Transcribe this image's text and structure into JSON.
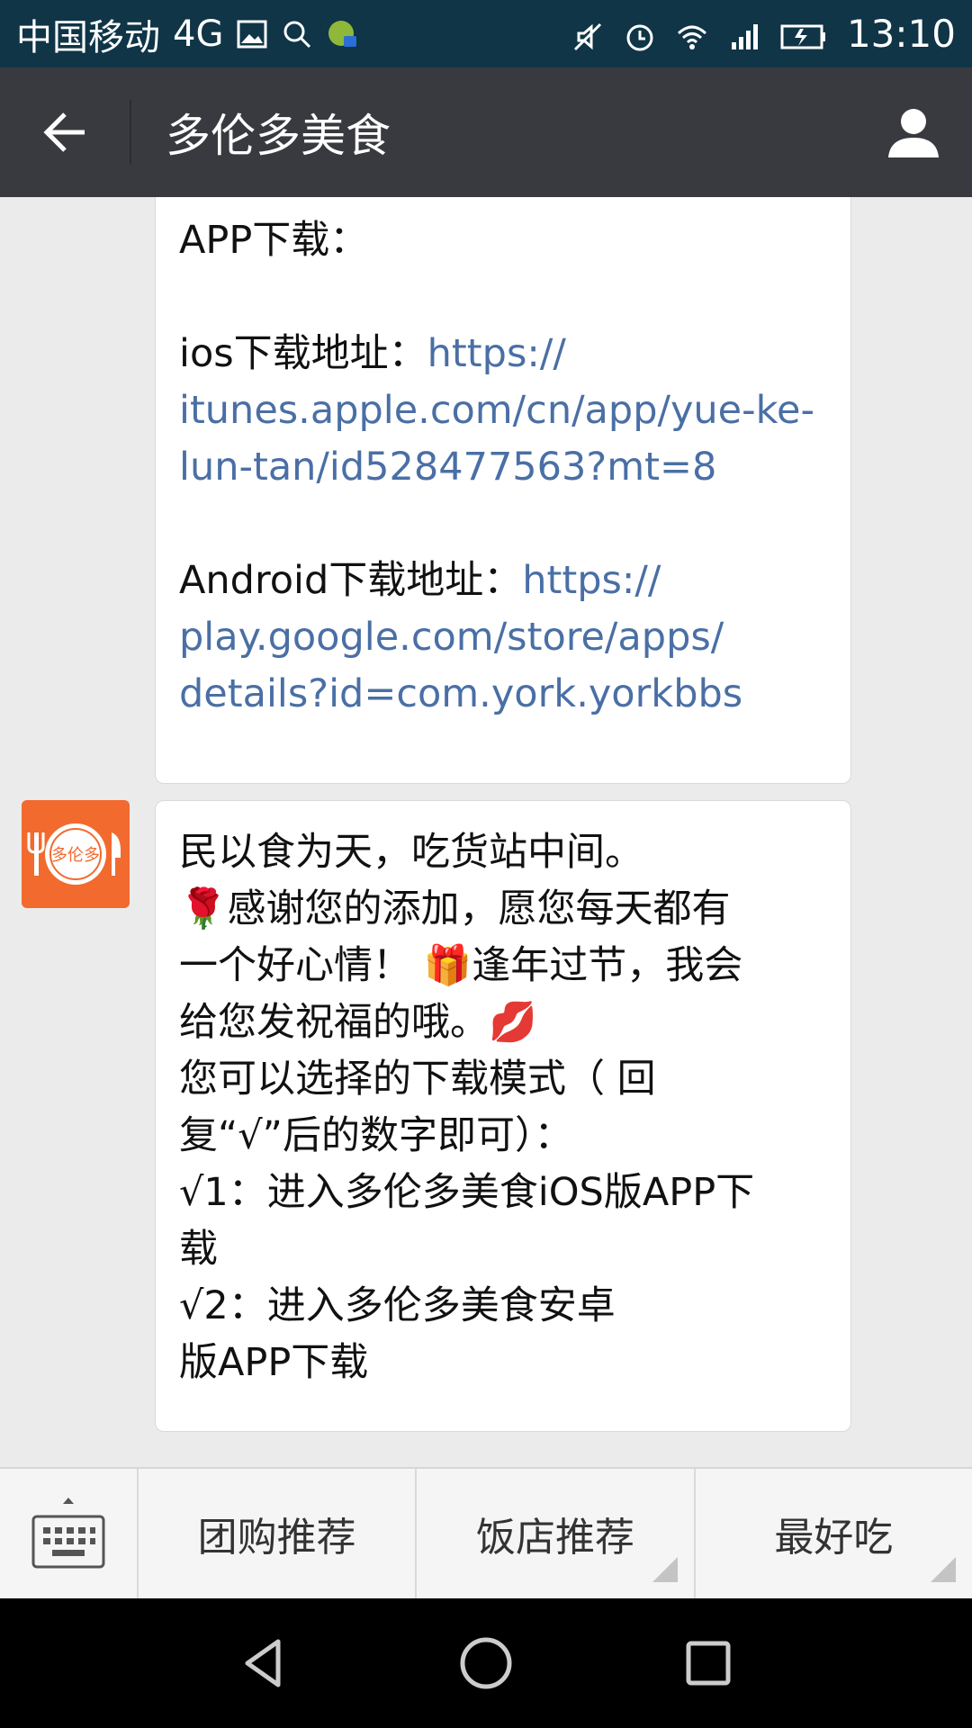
{
  "status_bar": {
    "carrier": "中国移动",
    "network": "4G",
    "time": "13:10",
    "icons": [
      "image-icon",
      "search-icon",
      "app-notification-icon",
      "mute-icon",
      "alarm-icon",
      "wifi-icon",
      "signal-icon",
      "battery-icon"
    ]
  },
  "header": {
    "title": "多伦多美食",
    "back_icon": "back-arrow-icon",
    "profile_icon": "person-icon"
  },
  "messages": [
    {
      "lines": [
        {
          "text": "APP下载：",
          "link": ""
        },
        {
          "gap": true
        },
        {
          "text": "ios下载地址：",
          "link": "https://"
        },
        {
          "text": "",
          "link": "itunes.apple.com/cn/app/yue-ke-"
        },
        {
          "text": "",
          "link": "lun-tan/id528477563?mt=8"
        },
        {
          "gap": true
        },
        {
          "text": "Android下载地址：",
          "link": "https://"
        },
        {
          "text": "",
          "link": "play.google.com/store/apps/"
        },
        {
          "text": "",
          "link": "details?id=com.york.yorkbbs"
        }
      ]
    },
    {
      "avatar_text": "多伦多",
      "lines": [
        "民以食为天，吃货站中间。",
        "🌹感谢您的添加，愿您每天都有",
        "一个好心情！ 🎁逢年过节，我会",
        "给您发祝福的哦。💋",
        "您可以选择的下载模式（ 回",
        "复“√”后的数字即可）：",
        "√1：进入多伦多美食iOS版APP下",
        "载",
        "√2：进入多伦多美食安卓",
        "版APP下载"
      ]
    }
  ],
  "menu": {
    "keyboard_icon": "keyboard-icon",
    "items": [
      "团购推荐",
      "饭店推荐",
      "最好吃"
    ]
  },
  "nav": [
    "back-triangle-icon",
    "home-circle-icon",
    "recents-square-icon"
  ],
  "colors": {
    "status_bar": "#0f3547",
    "title_bar": "#393a3f",
    "chat_bg": "#ebebeb",
    "link": "#4a6fa5",
    "avatar": "#f26a2e"
  }
}
